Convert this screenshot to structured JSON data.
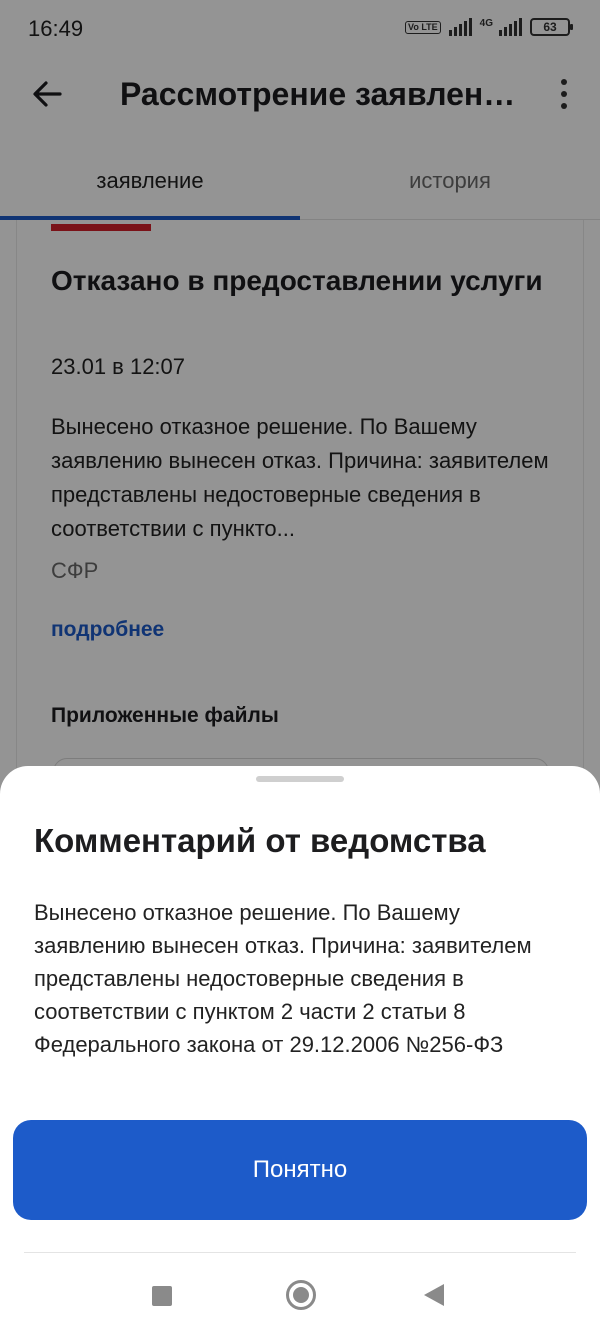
{
  "status_bar": {
    "time": "16:49",
    "battery": "63",
    "network": "4G",
    "volte": "Vo LTE"
  },
  "app_bar": {
    "title": "Рассмотрение заявлен…"
  },
  "tabs": [
    {
      "label": "заявление",
      "active": true
    },
    {
      "label": "история",
      "active": false
    }
  ],
  "card": {
    "title": "Отказано в предоставлении услуги",
    "date": "23.01 в 12:07",
    "description": "Вынесено отказное решение. По Вашему заявлению вынесен отказ. Причина: заявителем представлены недостоверные сведения в соответствии с пункто...",
    "organization": "СФР",
    "more_link": "подробнее",
    "files_title": "Приложенные файлы"
  },
  "sheet": {
    "title": "Комментарий от ведомства",
    "text": "Вынесено отказное решение. По Вашему заявлению вынесен отказ. Причина: заявителем представлены недостоверные сведения в соответствии с пунктом 2 части 2 статьи 8 Федерального закона от 29.12.2006 №256-ФЗ",
    "button_label": "Понятно"
  },
  "colors": {
    "accent": "#1d5bc9",
    "status_red": "#d21f2a"
  },
  "icons": {
    "back": "arrow-left-icon",
    "more": "more-vertical-icon"
  }
}
